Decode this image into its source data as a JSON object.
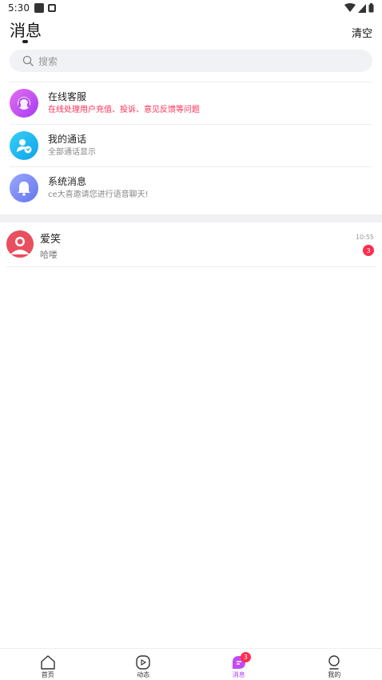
{
  "status_bar": {
    "time": "5:30"
  },
  "header": {
    "title": "消息",
    "clear_label": "清空"
  },
  "search": {
    "placeholder": "搜索"
  },
  "system_items": [
    {
      "title": "在线客服",
      "subtitle": "在线处理用户充值、投诉、意见反馈等问题",
      "icon": "headset-icon",
      "color": "#c245f0"
    },
    {
      "title": "我的通话",
      "subtitle": "全部通话显示",
      "icon": "call-user-icon",
      "color": "#1ab6f2"
    },
    {
      "title": "系统消息",
      "subtitle": "ce大喜邀请您进行语音聊天!",
      "icon": "bell-icon",
      "color": "#7a8cf5"
    }
  ],
  "chats": [
    {
      "name": "爱笑",
      "message": "哈喽",
      "time": "10:55",
      "unread": "3"
    }
  ],
  "tabbar": {
    "items": [
      {
        "label": "首页",
        "icon": "home-icon"
      },
      {
        "label": "动态",
        "icon": "play-icon"
      },
      {
        "label": "消息",
        "icon": "message-icon",
        "badge": "3"
      },
      {
        "label": "我的",
        "icon": "profile-icon"
      }
    ],
    "active_color": "#b33cf0"
  }
}
